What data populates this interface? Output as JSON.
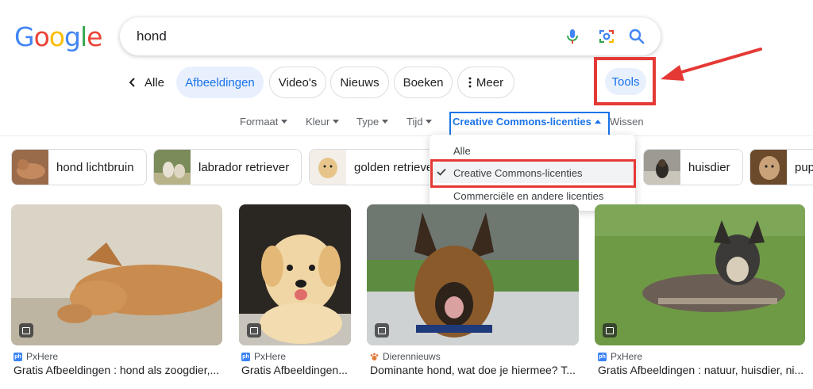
{
  "logo": {
    "letters": [
      "G",
      "o",
      "o",
      "g",
      "l",
      "e"
    ],
    "colors": [
      "#4285F4",
      "#EA4335",
      "#FBBC05",
      "#4285F4",
      "#34A853",
      "#EA4335"
    ]
  },
  "search": {
    "query": "hond",
    "icons": [
      "microphone-icon",
      "lens-camera-icon",
      "search-icon"
    ]
  },
  "tabs": {
    "back_label": "Alle",
    "items": [
      "Afbeeldingen",
      "Video's",
      "Nieuws",
      "Boeken",
      "Meer"
    ],
    "active": "Afbeeldingen",
    "tools_label": "Tools"
  },
  "filters": {
    "items": [
      "Formaat",
      "Kleur",
      "Type",
      "Tijd"
    ],
    "active_label": "Creative Commons-licenties",
    "clear_label": "Wissen"
  },
  "dropdown": {
    "options": [
      "Alle",
      "Creative Commons-licenties",
      "Commerciële en andere licenties"
    ],
    "selected": "Creative Commons-licenties"
  },
  "chips": [
    {
      "label": "hond lichtbruin"
    },
    {
      "label": "labrador retriever"
    },
    {
      "label": "golden retrieve"
    },
    {
      "label": "huisdier"
    },
    {
      "label": "pup"
    }
  ],
  "results": [
    {
      "source": "PxHere",
      "favicon": "ph",
      "caption": "Gratis Afbeeldingen : hond als zoogdier,..."
    },
    {
      "source": "PxHere",
      "favicon": "ph",
      "caption": "Gratis Afbeeldingen..."
    },
    {
      "source": "Dierennieuws",
      "favicon": "paw",
      "caption": "Dominante hond, wat doe je hiermee? T..."
    },
    {
      "source": "PxHere",
      "favicon": "ph",
      "caption": "Gratis Afbeeldingen : natuur, huisdier, ni..."
    }
  ],
  "colors": {
    "accent": "#1a73e8",
    "highlight_red": "#e53935"
  }
}
